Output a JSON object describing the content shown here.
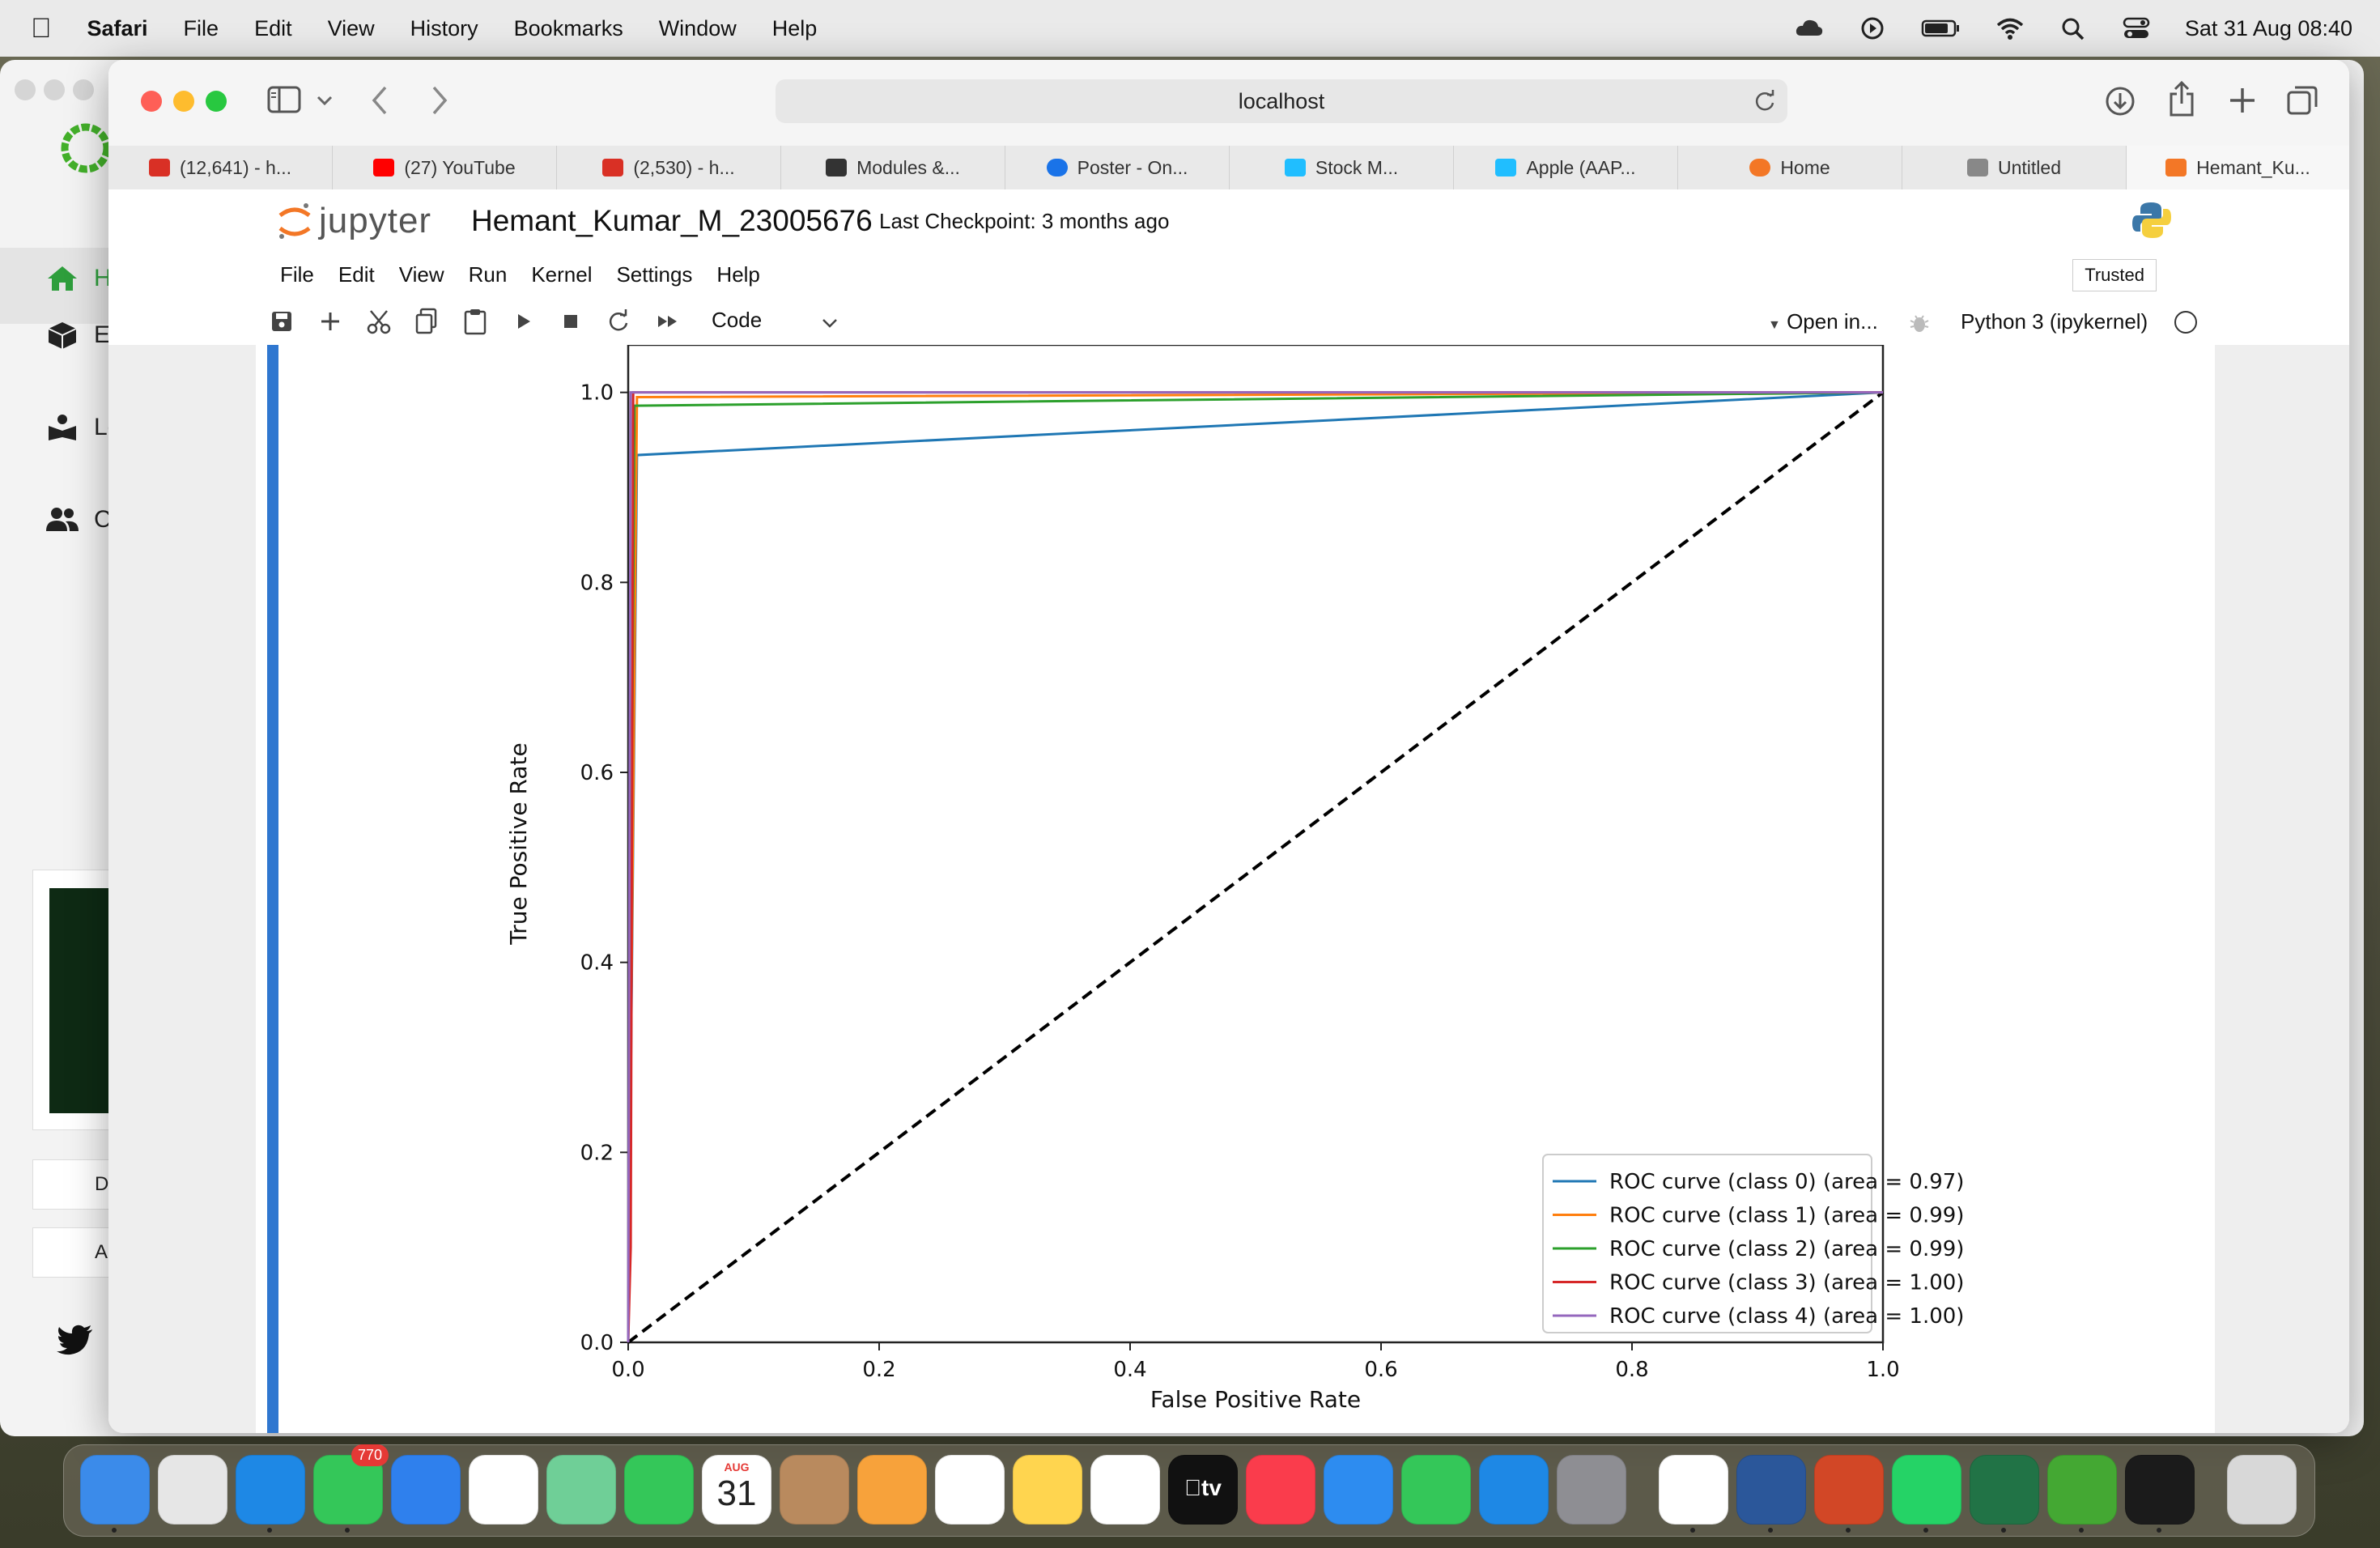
{
  "menubar": {
    "app": "Safari",
    "items": [
      "File",
      "Edit",
      "View",
      "History",
      "Bookmarks",
      "Window",
      "Help"
    ],
    "clock": "Sat 31 Aug  08:40"
  },
  "background_window": {
    "sidebar": [
      "Ho",
      "En",
      "Le",
      "Co"
    ],
    "buttons": [
      "D",
      "A"
    ]
  },
  "browser": {
    "url": "localhost",
    "tabs": [
      {
        "label": "(12,641) - h...",
        "icon": "gmail-icon",
        "color": "#d93025"
      },
      {
        "label": "(27) YouTube",
        "icon": "youtube-icon",
        "color": "#ff0000"
      },
      {
        "label": "(2,530) - h...",
        "icon": "gmail-icon",
        "color": "#d93025"
      },
      {
        "label": "Modules &...",
        "icon": "chart-icon",
        "color": "#333333"
      },
      {
        "label": "Poster - On...",
        "icon": "onedrive-icon",
        "color": "#1a73e8"
      },
      {
        "label": "Stock M...",
        "icon": "kaggle-icon",
        "color": "#20beff"
      },
      {
        "label": "Apple (AAP...",
        "icon": "kaggle-icon",
        "color": "#20beff"
      },
      {
        "label": "Home",
        "icon": "jupyter-icon",
        "color": "#f37726"
      },
      {
        "label": "Untitled",
        "icon": "letter-l-icon",
        "color": "#888888"
      },
      {
        "label": "Hemant_Ku...",
        "icon": "notebook-icon",
        "color": "#f37726"
      }
    ]
  },
  "jupyter": {
    "logo_text": "jupyter",
    "notebook_title": "Hemant_Kumar_M_23005676",
    "checkpoint": "Last Checkpoint: 3 months ago",
    "menu": [
      "File",
      "Edit",
      "View",
      "Run",
      "Kernel",
      "Settings",
      "Help"
    ],
    "trusted": "Trusted",
    "cell_type": "Code",
    "open_in": "Open in...",
    "kernel": "Python 3 (ipykernel)"
  },
  "chart_data": {
    "type": "line",
    "title": "",
    "xlabel": "False Positive Rate",
    "ylabel": "True Positive Rate",
    "xlim": [
      0.0,
      1.0
    ],
    "ylim": [
      0.0,
      1.05
    ],
    "xticks": [
      "0.0",
      "0.2",
      "0.4",
      "0.6",
      "0.8",
      "1.0"
    ],
    "yticks": [
      "0.0",
      "0.2",
      "0.4",
      "0.6",
      "0.8",
      "1.0"
    ],
    "legend_position": "lower-right",
    "grid": false,
    "series": [
      {
        "name": "ROC curve (class 0) (area = 0.97)",
        "color": "#1f77b4",
        "x": [
          0.0,
          0.0,
          0.007,
          1.0
        ],
        "y": [
          0.0,
          0.0,
          0.934,
          1.0
        ]
      },
      {
        "name": "ROC curve (class 1) (area = 0.99)",
        "color": "#ff7f0e",
        "x": [
          0.0,
          0.0,
          0.007,
          1.0
        ],
        "y": [
          0.0,
          0.0,
          0.995,
          1.0
        ]
      },
      {
        "name": "ROC curve (class 2) (area = 0.99)",
        "color": "#2ca02c",
        "x": [
          0.0,
          0.0,
          0.005,
          1.0
        ],
        "y": [
          0.0,
          0.0,
          0.986,
          1.0
        ]
      },
      {
        "name": "ROC curve (class 3) (area = 1.00)",
        "color": "#d62728",
        "x": [
          0.0,
          0.002,
          0.004,
          1.0
        ],
        "y": [
          0.0,
          0.1,
          1.0,
          1.0
        ]
      },
      {
        "name": "ROC curve (class 4) (area = 1.00)",
        "color": "#9467bd",
        "x": [
          0.0,
          0.0,
          0.002,
          1.0
        ],
        "y": [
          0.0,
          0.0,
          1.0,
          1.0
        ]
      }
    ],
    "diagonal": {
      "x": [
        0.0,
        1.0
      ],
      "y": [
        0.0,
        1.0
      ],
      "color": "#000000",
      "style": "dashed"
    }
  },
  "dock": {
    "apps": [
      {
        "name": "finder-icon",
        "color": "#3b8bea"
      },
      {
        "name": "launchpad-icon",
        "color": "#e6e6e6"
      },
      {
        "name": "safari-icon",
        "color": "#1e88e5"
      },
      {
        "name": "messages-icon",
        "color": "#34c759",
        "badge": "770"
      },
      {
        "name": "mail-icon",
        "color": "#2f80ed"
      },
      {
        "name": "photos-icon",
        "color": "#ffffff"
      },
      {
        "name": "maps-icon",
        "color": "#6fcf97"
      },
      {
        "name": "facetime-icon",
        "color": "#34c759"
      },
      {
        "name": "calendar-icon",
        "color": "#ffffff",
        "month": "AUG",
        "day": "31"
      },
      {
        "name": "contacts-icon",
        "color": "#b98a5e"
      },
      {
        "name": "pages-icon",
        "color": "#f7a23b"
      },
      {
        "name": "reminders-icon",
        "color": "#ffffff"
      },
      {
        "name": "notes-icon",
        "color": "#ffd54f"
      },
      {
        "name": "freeform-icon",
        "color": "#ffffff"
      },
      {
        "name": "appletv-icon",
        "color": "#111111",
        "label": "tv"
      },
      {
        "name": "music-icon",
        "color": "#fa3c4c"
      },
      {
        "name": "keynote-icon",
        "color": "#2d8cf0"
      },
      {
        "name": "numbers-icon",
        "color": "#34c759"
      },
      {
        "name": "appstore-icon",
        "color": "#1e88e5"
      },
      {
        "name": "settings-icon",
        "color": "#8e8e93"
      },
      {
        "name": "chrome-icon",
        "color": "#ffffff"
      },
      {
        "name": "word-icon",
        "color": "#2b579a"
      },
      {
        "name": "powerpoint-icon",
        "color": "#d24726"
      },
      {
        "name": "whatsapp-icon",
        "color": "#25d366"
      },
      {
        "name": "excel-icon",
        "color": "#217346"
      },
      {
        "name": "anaconda-icon",
        "color": "#44a833"
      },
      {
        "name": "terminal-icon",
        "color": "#1b1b1b"
      },
      {
        "name": "trash-icon",
        "color": "#d8d8d8"
      }
    ]
  }
}
